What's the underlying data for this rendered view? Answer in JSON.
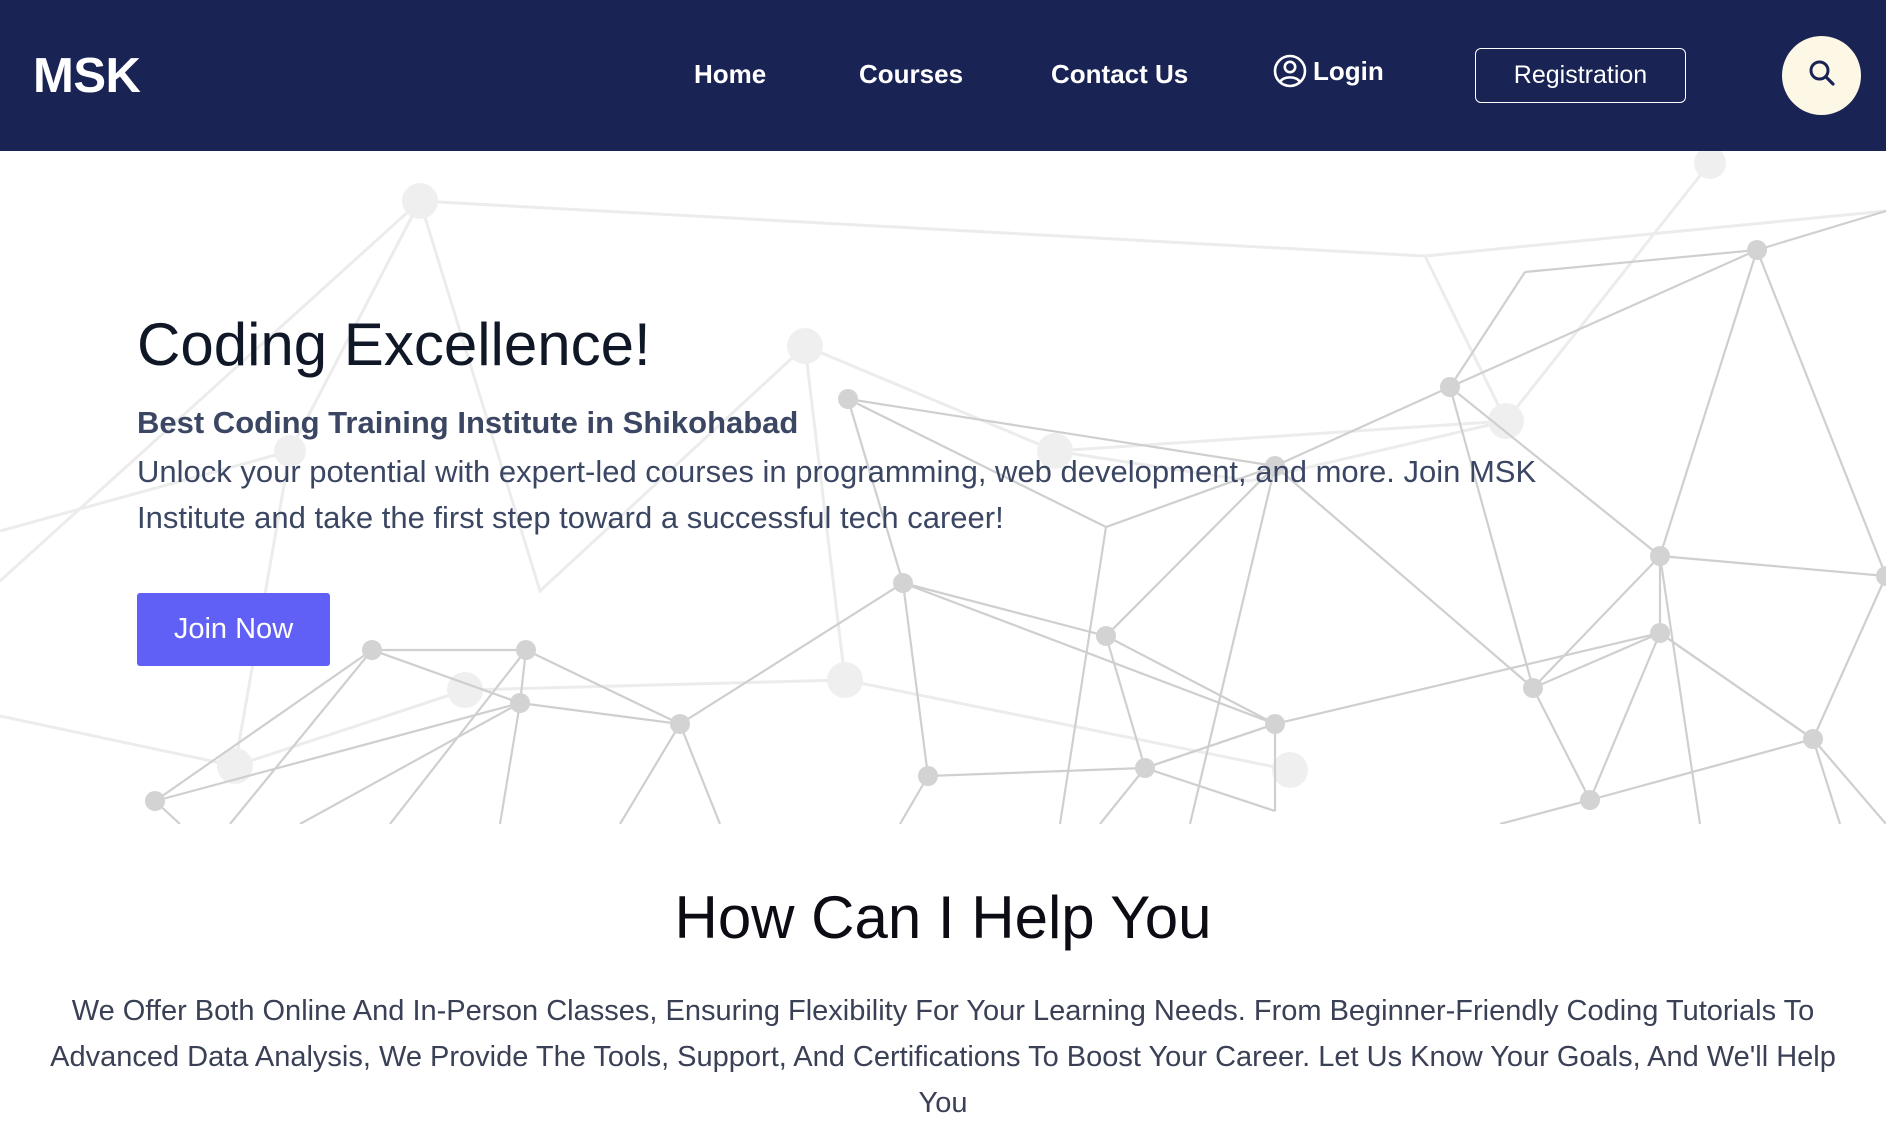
{
  "header": {
    "logo": "MSK",
    "nav": {
      "home": "Home",
      "courses": "Courses",
      "contact": "Contact Us",
      "login": "Login"
    },
    "registration_label": "Registration",
    "colors": {
      "background": "#192354",
      "search_button_bg": "#fdf7e6"
    },
    "icons": {
      "login": "user-circle-icon",
      "search": "search-icon"
    }
  },
  "hero": {
    "title": "Coding Excellence!",
    "subtitle": "Best Coding Training Institute in Shikohabad",
    "description": "Unlock your potential with expert-led courses in programming, web development, and more. Join MSK Institute and take the first step toward a successful tech career!",
    "join_button": "Join Now",
    "colors": {
      "join_button": "#6160f6"
    }
  },
  "help": {
    "title": "How Can I Help You",
    "text": "We Offer Both Online And In-Person Classes, Ensuring Flexibility For Your Learning Needs. From Beginner-Friendly Coding Tutorials To Advanced Data Analysis, We Provide The Tools, Support, And Certifications To Boost Your Career. Let Us Know Your Goals, And We'll Help You"
  }
}
